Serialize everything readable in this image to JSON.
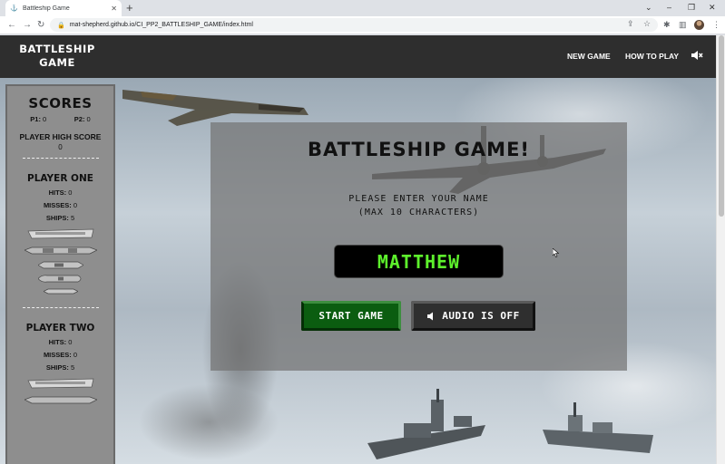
{
  "browser": {
    "tab_title": "Battleship Game",
    "url": "mat-shepherd.github.io/CI_PP2_BATTLESHIP_GAME/index.html"
  },
  "navbar": {
    "brand_line1": "BATTLESHIP",
    "brand_line2": "GAME",
    "new_game": "NEW GAME",
    "how_to_play": "HOW TO PLAY"
  },
  "sidebar": {
    "scores_title": "SCORES",
    "p1_label": "P1:",
    "p1_score": "0",
    "p2_label": "P2:",
    "p2_score": "0",
    "high_score_label": "PLAYER HIGH SCORE",
    "high_score_value": "0",
    "player_one": {
      "title": "PLAYER ONE",
      "hits_label": "HITS:",
      "hits": "0",
      "misses_label": "MISSES:",
      "misses": "0",
      "ships_label": "SHIPS:",
      "ships": "5"
    },
    "player_two": {
      "title": "PLAYER TWO",
      "hits_label": "HITS:",
      "hits": "0",
      "misses_label": "MISSES:",
      "misses": "0",
      "ships_label": "SHIPS:",
      "ships": "5"
    }
  },
  "modal": {
    "title": "BATTLESHIP GAME!",
    "prompt_line1": "PLEASE ENTER YOUR NAME",
    "prompt_line2": "(MAX 10 CHARACTERS)",
    "name_value": "MATTHEW",
    "start_button": "START GAME",
    "audio_button": "AUDIO IS OFF"
  },
  "colors": {
    "navbar_bg": "#2e2e2e",
    "start_green": "#0b5d10",
    "input_text_green": "#5df12c"
  }
}
